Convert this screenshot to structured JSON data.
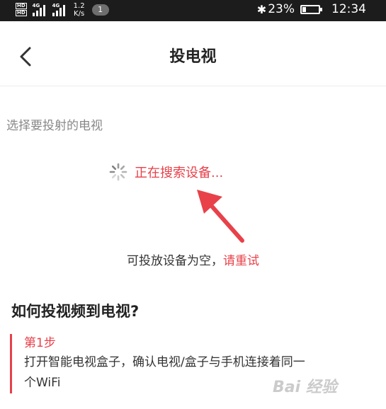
{
  "status_bar": {
    "sim1_label": "HD",
    "sim2_label": "HD",
    "signal1_label": "4G",
    "signal2_label": "4G",
    "net_speed_value": "1.2",
    "net_speed_unit": "K/s",
    "notification_count": "1",
    "battery_percent": "23%",
    "battery_level": 0.23,
    "time": "12:34"
  },
  "header": {
    "title": "投电视"
  },
  "tv_section": {
    "label": "选择要投射的电视",
    "searching_text": "正在搜索设备...",
    "empty_text": "可投放设备为空，",
    "retry_label": "请重试"
  },
  "help": {
    "title": "如何投视频到电视?",
    "steps": [
      {
        "title": "第1步",
        "desc_line1": "打开智能电视盒子，确认电视/盒子与手机连接着同一",
        "desc_line2": "个WiFi"
      }
    ]
  },
  "watermark": "Bai 经验",
  "colors": {
    "accent": "#e8414a",
    "status_bar_bg": "#1c1c1c"
  }
}
